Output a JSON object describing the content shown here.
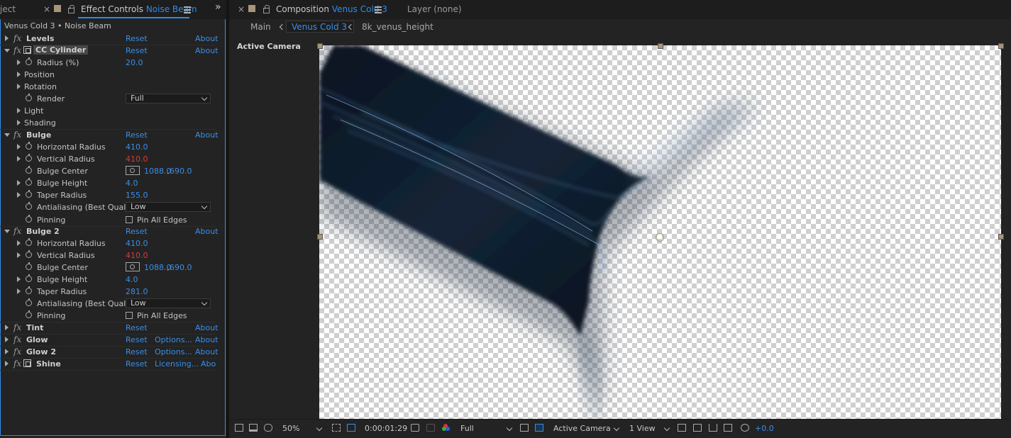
{
  "left_tabs": {
    "project_partial": "ject",
    "effect_controls_label": "Effect Controls",
    "effect_controls_layer": "Noise Beam"
  },
  "ec_header": "Venus Cold 3 • Noise Beam",
  "effects": {
    "reset": "Reset",
    "about": "About",
    "about_partial": "Abo",
    "options": "Options...",
    "licensing": "Licensing...",
    "levels": "Levels",
    "cc_cylinder": "CC Cylinder",
    "radius_label": "Radius (%)",
    "radius_value": "20.0",
    "position": "Position",
    "rotation": "Rotation",
    "render_label": "Render",
    "render_value": "Full",
    "light": "Light",
    "shading": "Shading",
    "bulge": "Bulge",
    "bulge2": "Bulge 2",
    "h_radius_label": "Horizontal Radius",
    "h_radius_value": "410.0",
    "v_radius_label": "Vertical Radius",
    "v_radius_value": "410.0",
    "bulge_center_label": "Bulge Center",
    "bulge_center_x": "1088.0",
    "bulge_center_y": "690.0",
    "bulge_height_label": "Bulge Height",
    "bulge_height_value": "4.0",
    "taper_label": "Taper Radius",
    "taper1_value": "155.0",
    "taper2_value": "281.0",
    "aa_label": "Antialiasing (Best Qual",
    "aa_value": "Low",
    "pinning_label": "Pinning",
    "pin_all_edges": "Pin All Edges",
    "tint": "Tint",
    "glow": "Glow",
    "glow2": "Glow 2",
    "shine": "Shine"
  },
  "comp_tabs": {
    "composition_label": "Composition",
    "composition_name": "Venus Cold 3",
    "layer_tab": "Layer (none)"
  },
  "breadcrumbs": [
    "Main",
    "Venus Cold 3",
    "8k_venus_height"
  ],
  "viewer": {
    "camera_label": "Active Camera"
  },
  "toolbar": {
    "zoom": "50%",
    "timecode": "0:00:01:29",
    "resolution": "Full",
    "camera": "Active Camera",
    "views": "1 View",
    "exposure": "+0.0"
  },
  "colors": {
    "accent": "#2d8ceb",
    "value_blue": "#3a8ee6",
    "value_red": "#d63a3a",
    "panel_bg": "#232323"
  }
}
